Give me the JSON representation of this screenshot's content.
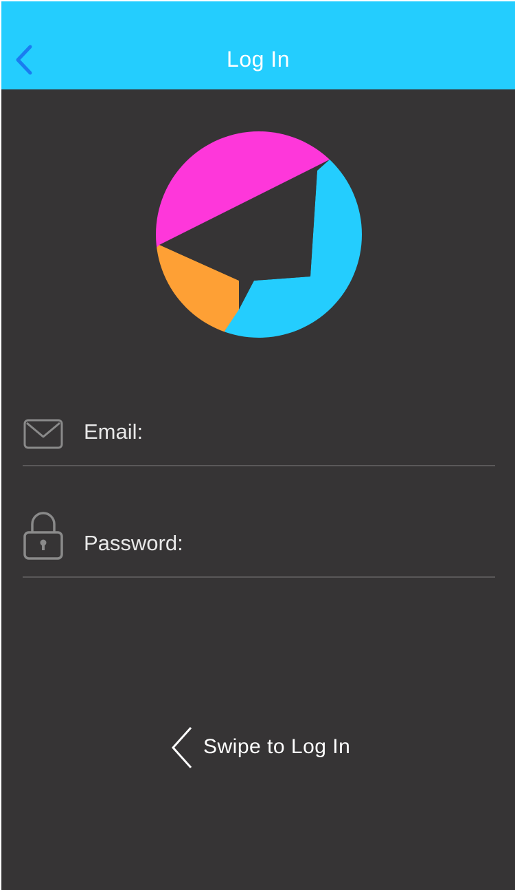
{
  "navbar": {
    "title": "Log In",
    "back_icon": "chevron-left-icon",
    "background_color": "#24cdfe",
    "back_icon_color": "#1a7cf0"
  },
  "logo": {
    "icon": "paper-plane-logo",
    "colors": {
      "magenta": "#fe37da",
      "cyan": "#24cdfe",
      "orange": "#fea035",
      "dark": "#363435"
    }
  },
  "form": {
    "email": {
      "label": "Email:",
      "icon": "envelope-icon",
      "value": ""
    },
    "password": {
      "label": "Password:",
      "icon": "padlock-icon",
      "value": ""
    }
  },
  "swipe": {
    "label": "Swipe to Log In",
    "icon": "chevron-left-icon"
  },
  "theme": {
    "background": "#363435",
    "text": "#e8e8e8",
    "icon_gray": "#8a8a8a"
  }
}
